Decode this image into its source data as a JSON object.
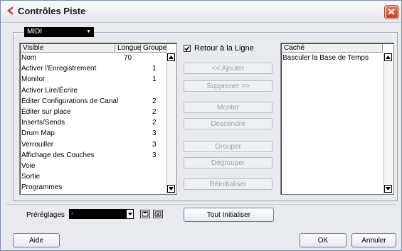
{
  "window": {
    "title": "Contrôles Piste",
    "close_icon": "close-icon"
  },
  "top_combo": {
    "value": "MIDI"
  },
  "visible_list": {
    "headers": [
      "Visible",
      "Longue",
      "Groupe"
    ],
    "rows": [
      {
        "name": "Nom",
        "longue": "70",
        "groupe": ""
      },
      {
        "name": "Activer l'Enregistrement",
        "longue": "",
        "groupe": "1"
      },
      {
        "name": "Monitor",
        "longue": "",
        "groupe": "1"
      },
      {
        "name": "Activer Lire/Écrire",
        "longue": "",
        "groupe": ""
      },
      {
        "name": "Éditer Configurations de Canal",
        "longue": "",
        "groupe": "2"
      },
      {
        "name": "Éditer sur place",
        "longue": "",
        "groupe": "2"
      },
      {
        "name": "Inserts/Sends",
        "longue": "",
        "groupe": "2"
      },
      {
        "name": "Drum Map",
        "longue": "",
        "groupe": "3"
      },
      {
        "name": "Verrouiller",
        "longue": "",
        "groupe": "3"
      },
      {
        "name": "Affichage des Couches",
        "longue": "",
        "groupe": "3"
      },
      {
        "name": "Voie",
        "longue": "",
        "groupe": ""
      },
      {
        "name": "Sortie",
        "longue": "",
        "groupe": ""
      },
      {
        "name": "Programmes",
        "longue": "",
        "groupe": ""
      }
    ]
  },
  "wrap_checkbox": {
    "label": "Retour à la Ligne",
    "checked": true
  },
  "middle_buttons": [
    {
      "label": "<< Ajouter",
      "enabled": false
    },
    {
      "label": "Supprimer >>",
      "enabled": false
    },
    {
      "label": "Monter",
      "enabled": false
    },
    {
      "label": "Descendre",
      "enabled": false
    },
    {
      "label": "Grouper",
      "enabled": false
    },
    {
      "label": "Dégrouper",
      "enabled": false
    },
    {
      "label": "Réinitialiser",
      "enabled": false
    }
  ],
  "hidden_list": {
    "header": "Caché",
    "rows": [
      "Basculer la Base de Temps"
    ]
  },
  "presets": {
    "label": "Préréglages",
    "value": "-"
  },
  "buttons": {
    "reset_all": "Tout Initialiser",
    "help": "Aide",
    "ok": "OK",
    "cancel": "Annuler"
  },
  "colors": {
    "accent": "#c7401f",
    "button_border": "#5a7ab0"
  }
}
